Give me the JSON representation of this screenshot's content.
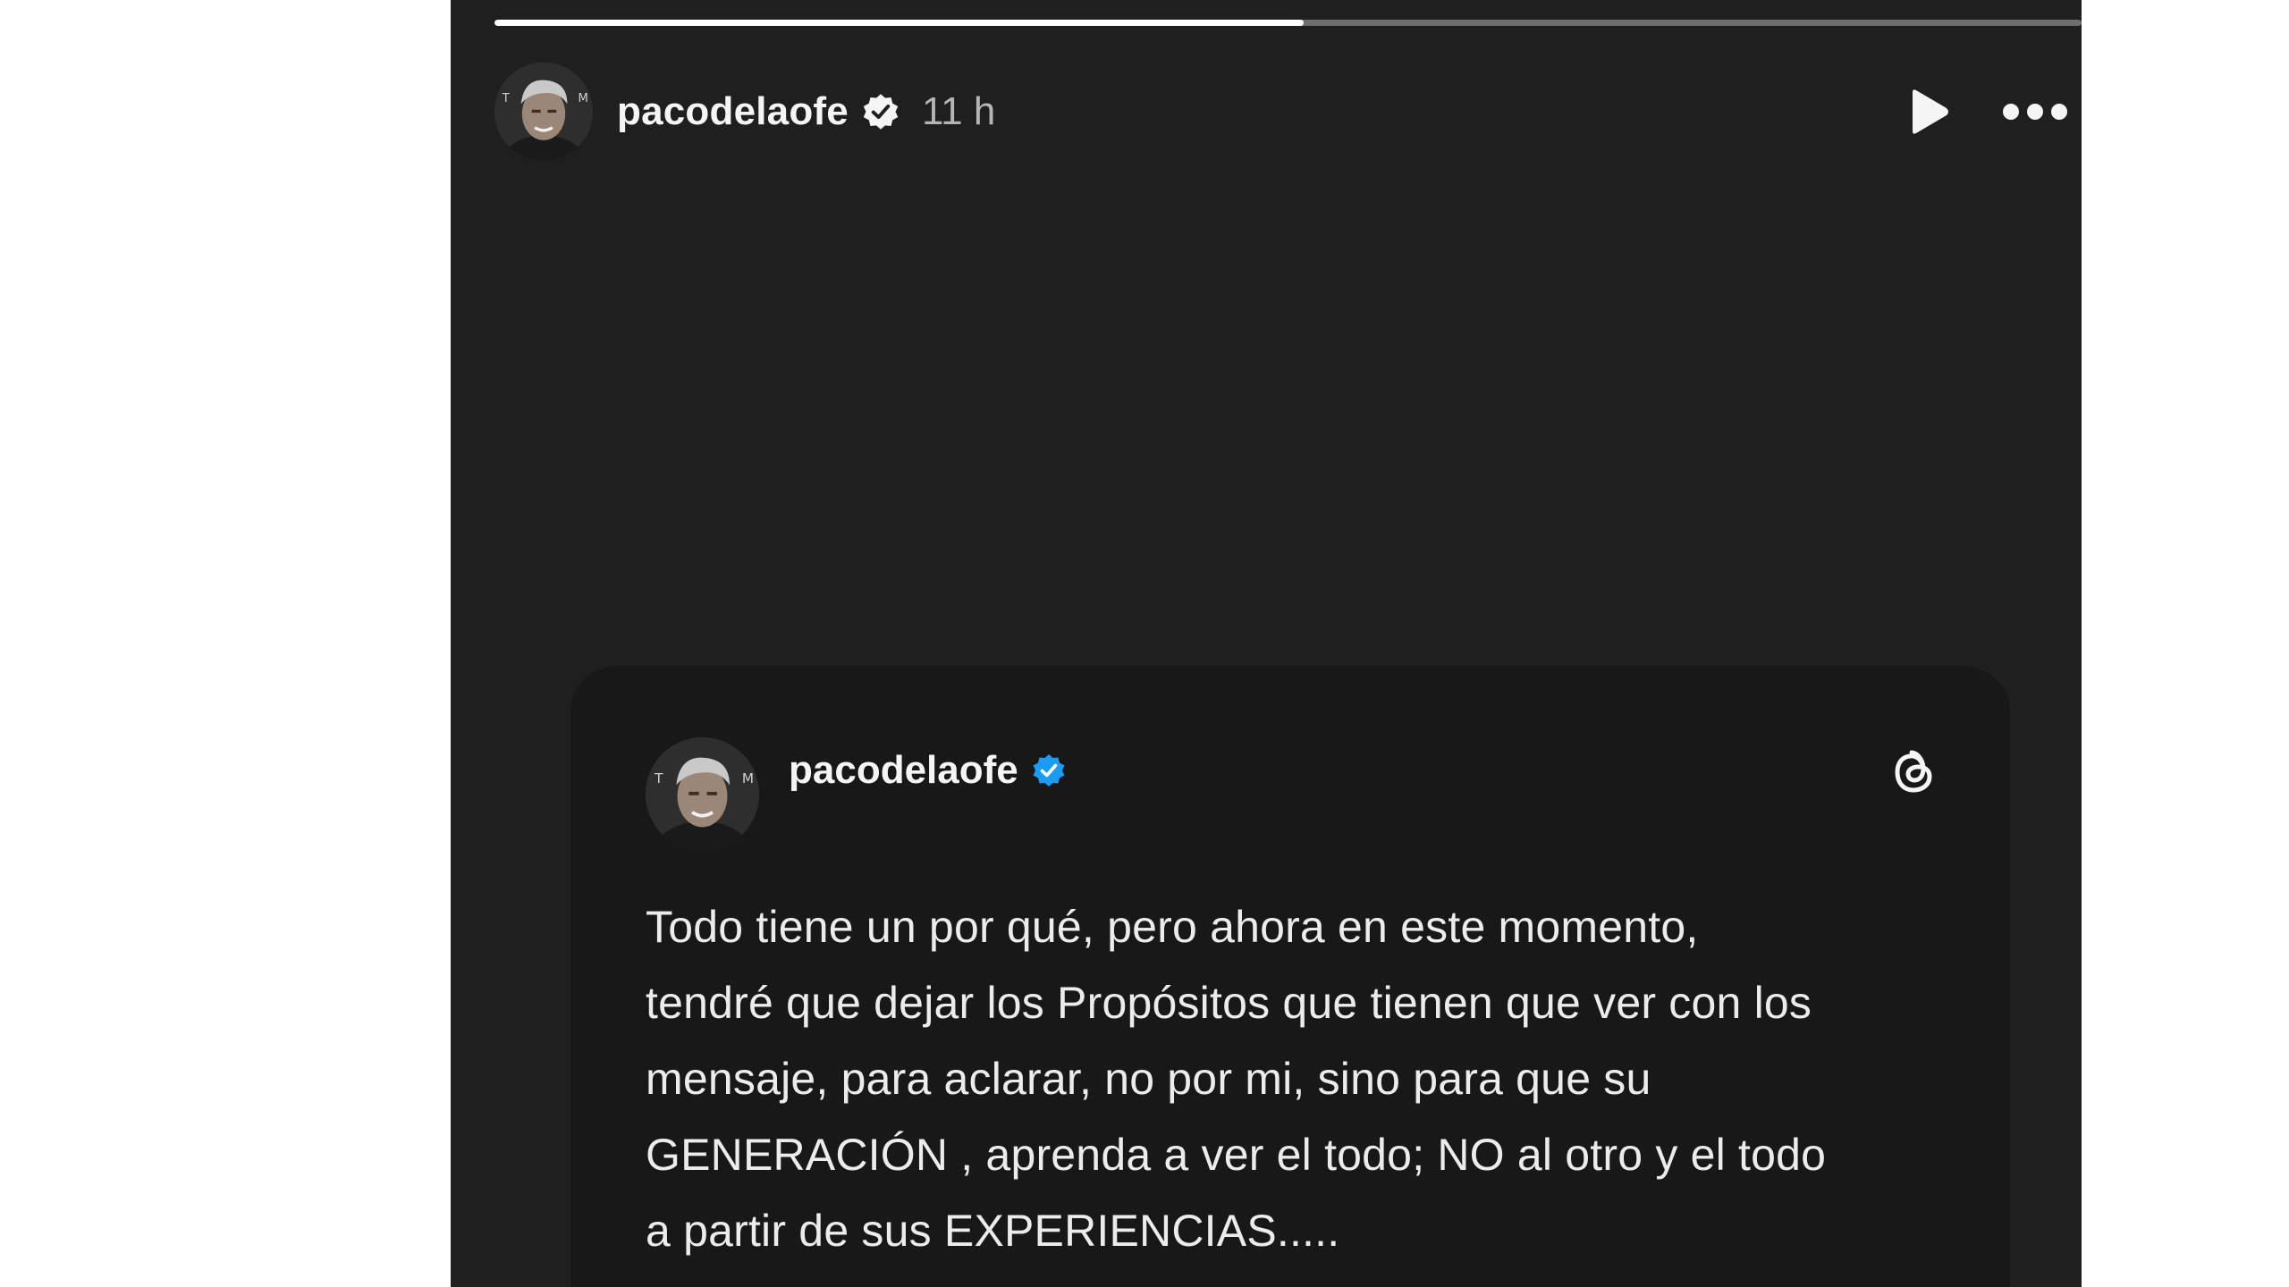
{
  "story": {
    "progress": 0.51,
    "header": {
      "username": "pacodelaofe",
      "time": "11 h",
      "play_icon": "play-icon",
      "more_icon": "more-horizontal-icon",
      "verified_icon": "verified-badge-icon"
    },
    "post_card": {
      "username": "pacodelaofe",
      "verified_icon": "verified-badge-blue-icon",
      "app_icon": "threads-logo-icon",
      "text_lines": [
        "Todo tiene un por qué, pero ahora en este momento,",
        "tendré que dejar los Propósitos que tienen que ver con los",
        "mensaje, para aclarar, no por mi, sino para que su",
        "GENERACIÓN , aprenda a ver el todo; NO al otro y el todo",
        "a partir de sus EXPERIENCIAS....."
      ]
    }
  },
  "colors": {
    "story_background": "#1f1f1f",
    "card_background": "#181818",
    "verified_blue": "#1d9bf0",
    "text_primary": "#f5f5f5",
    "text_secondary": "#b5b5b5",
    "progress_track": "#6e6e6e",
    "progress_fill": "#ffffff"
  }
}
